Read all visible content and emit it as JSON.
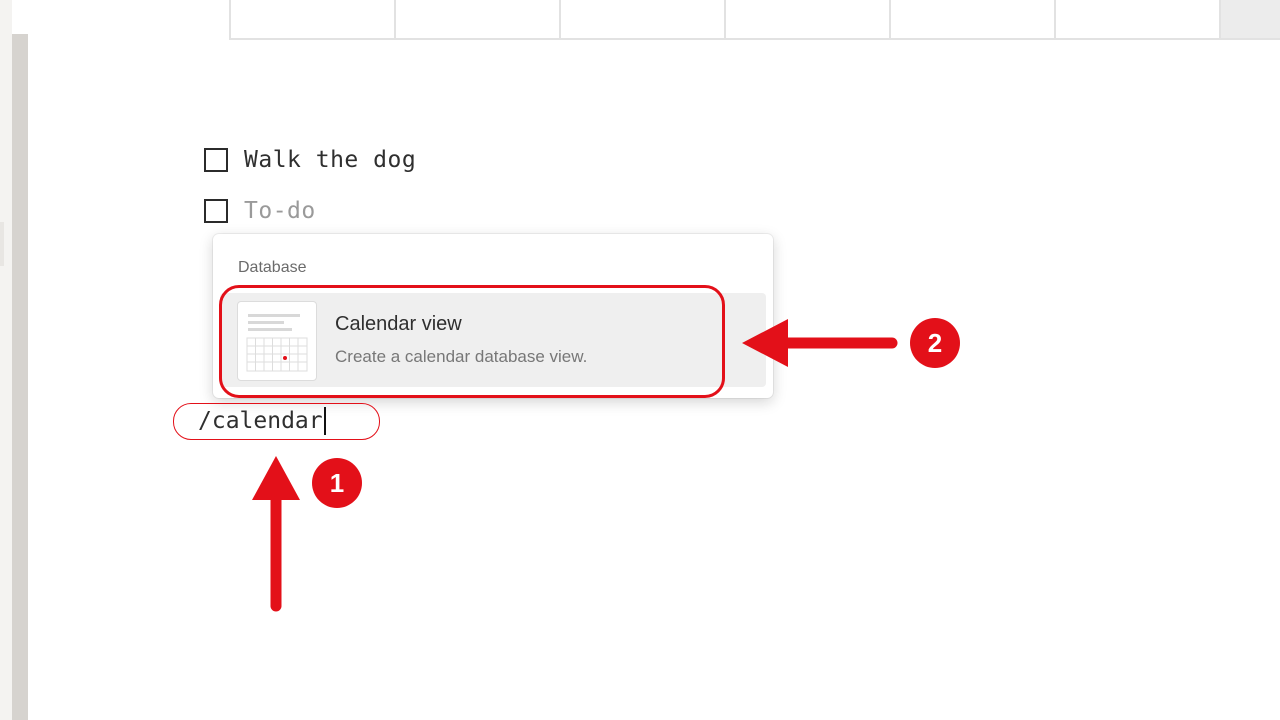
{
  "page": {
    "todos": [
      {
        "text": "Walk the dog",
        "checked": false
      },
      {
        "placeholder": "To-do",
        "checked": false
      }
    ],
    "command_input": {
      "value": "/calendar"
    }
  },
  "slash_menu": {
    "section_label": "Database",
    "items": [
      {
        "title": "Calendar view",
        "description": "Create a calendar database view.",
        "icon": "calendar-thumbnail-icon",
        "highlighted": true
      }
    ]
  },
  "annotations": {
    "steps": [
      {
        "number": "1",
        "target": "command-input"
      },
      {
        "number": "2",
        "target": "calendar-view-item"
      }
    ],
    "accent_color": "#e31019"
  }
}
